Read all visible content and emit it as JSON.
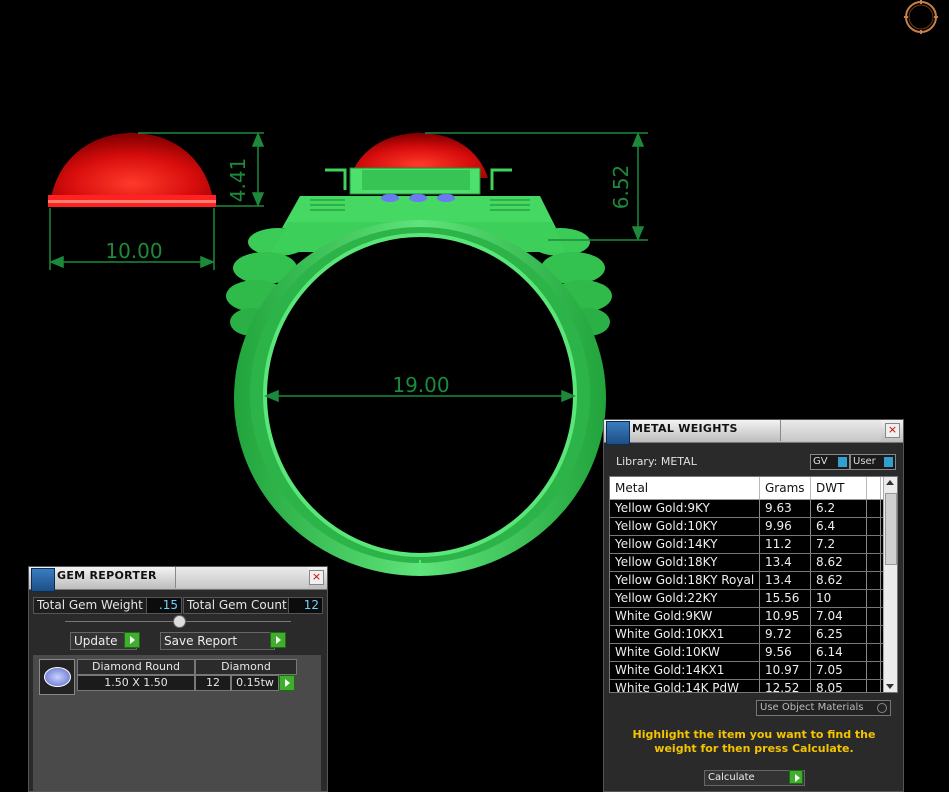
{
  "viewport": {
    "gem_height": "4.41",
    "gem_width": "10.00",
    "ring_height": "6.52",
    "ring_inner_diameter": "19.00"
  },
  "gem_reporter": {
    "title": "GEM REPORTER",
    "total_gem_weight_label": "Total Gem Weight",
    "total_gem_weight_value": ".15",
    "total_gem_count_label": "Total Gem Count",
    "total_gem_count_value": "12",
    "update_label": "Update",
    "save_report_label": "Save Report",
    "gem": {
      "name": "Diamond Round",
      "size": "1.50 X 1.50",
      "type": "Diamond",
      "count": "12",
      "weight": "0.15tw"
    }
  },
  "metal_weights": {
    "title": "METAL WEIGHTS",
    "library_label": "Library: METAL",
    "gv_label": "GV",
    "user_label": "User",
    "columns": [
      "Metal",
      "Grams",
      "DWT"
    ],
    "rows": [
      [
        "Yellow Gold:9KY",
        "9.63",
        "6.2"
      ],
      [
        "Yellow Gold:10KY",
        "9.96",
        "6.4"
      ],
      [
        "Yellow Gold:14KY",
        "11.2",
        "7.2"
      ],
      [
        "Yellow Gold:18KY",
        "13.4",
        "8.62"
      ],
      [
        "Yellow Gold:18KY Royal",
        "13.4",
        "8.62"
      ],
      [
        "Yellow Gold:22KY",
        "15.56",
        "10"
      ],
      [
        "White Gold:9KW",
        "10.95",
        "7.04"
      ],
      [
        "White Gold:10KX1",
        "9.72",
        "6.25"
      ],
      [
        "White Gold:10KW",
        "9.56",
        "6.14"
      ],
      [
        "White Gold:14KX1",
        "10.97",
        "7.05"
      ],
      [
        "White Gold:14K PdW",
        "12.52",
        "8.05"
      ]
    ],
    "use_object_materials_label": "Use Object Materials",
    "hint": "Highlight the item you want to find the weight for then press Calculate.",
    "calculate_label": "Calculate"
  },
  "colors": {
    "ring_green": "#37d457",
    "gem_red": "#e01010",
    "dimension_green": "#1c8a3a",
    "hint_yellow": "#f5c400",
    "value_blue": "#6fd0ff"
  }
}
